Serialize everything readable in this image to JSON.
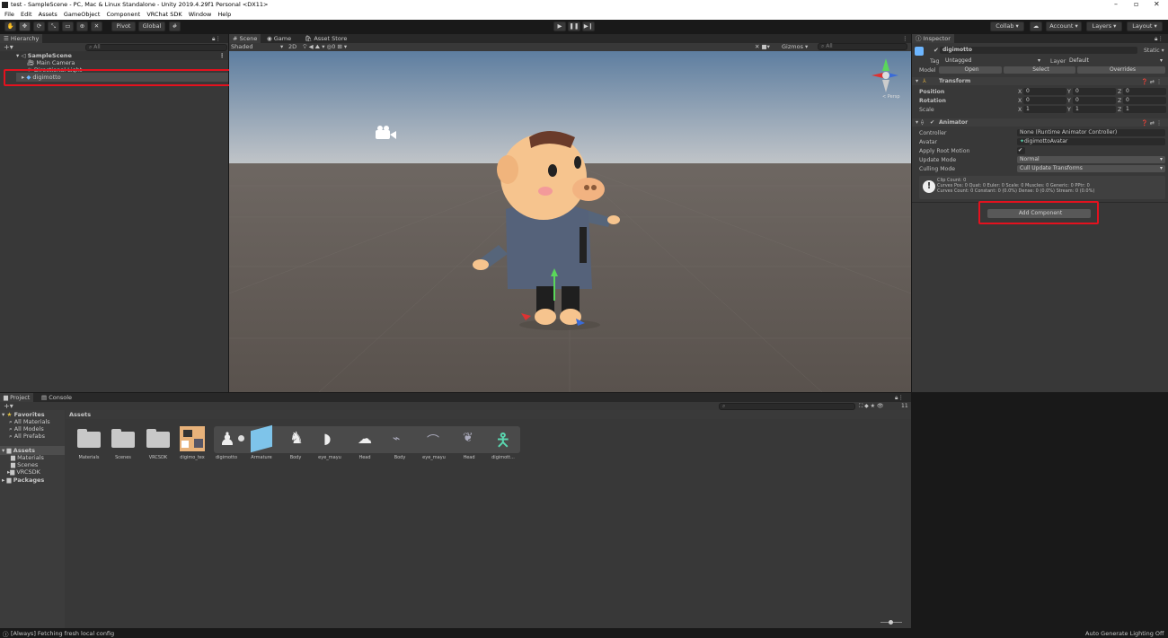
{
  "window": {
    "title": "test - SampleScene - PC, Mac & Linux Standalone - Unity 2019.4.29f1 Personal <DX11>",
    "min": "–",
    "max": "▫",
    "close": "✕"
  },
  "menu": [
    "File",
    "Edit",
    "Assets",
    "GameObject",
    "Component",
    "VRChat SDK",
    "Window",
    "Help"
  ],
  "toolbar": {
    "pivot": "Pivot",
    "global": "Global",
    "collab": "Collab ▾",
    "cloud": "☁",
    "account": "Account ▾",
    "layers": "Layers ▾",
    "layout": "Layout ▾"
  },
  "hierarchy": {
    "tab": "Hierarchy",
    "search_placeholder": "All",
    "scene": "SampleScene",
    "items": [
      "Main Camera",
      "Directional Light",
      "digimotto"
    ]
  },
  "scene": {
    "tabs": [
      "Scene",
      "Game",
      "Asset Store"
    ],
    "shading": "Shaded",
    "mode2d": "2D",
    "gizmos": "Gizmos ▾",
    "search_placeholder": "All",
    "persp": "< Persp"
  },
  "inspector": {
    "tab": "Inspector",
    "object_name": "digimotto",
    "static": "Static ▾",
    "tag_label": "Tag",
    "tag_value": "Untagged",
    "layer_label": "Layer",
    "layer_value": "Default",
    "model_label": "Model",
    "open": "Open",
    "select": "Select",
    "overrides": "Overrides",
    "transform": {
      "title": "Transform",
      "rows": [
        {
          "label": "Position",
          "x": "0",
          "y": "0",
          "z": "0"
        },
        {
          "label": "Rotation",
          "x": "0",
          "y": "0",
          "z": "0"
        },
        {
          "label": "Scale",
          "x": "1",
          "y": "1",
          "z": "1"
        }
      ]
    },
    "animator": {
      "title": "Animator",
      "fields": [
        {
          "label": "Controller",
          "value": "None (Runtime Animator Controller)"
        },
        {
          "label": "Avatar",
          "value": "digimottoAvatar"
        },
        {
          "label": "Apply Root Motion",
          "value": "✔"
        },
        {
          "label": "Update Mode",
          "value": "Normal"
        },
        {
          "label": "Culling Mode",
          "value": "Cull Update Transforms"
        }
      ],
      "info": [
        "Clip Count: 0",
        "Curves Pos: 0 Quat: 0 Euler: 0 Scale: 0 Muscles: 0 Generic: 0 PPtr: 0",
        "Curves Count: 0 Constant: 0 (0.0%) Dense: 0 (0.0%) Stream: 0 (0.0%)"
      ]
    },
    "add_component": "Add Component"
  },
  "project": {
    "tabs": [
      "Project",
      "Console"
    ],
    "favorites": {
      "title": "Favorites",
      "items": [
        "All Materials",
        "All Models",
        "All Prefabs"
      ]
    },
    "assets_tree": {
      "title": "Assets",
      "items": [
        "Materials",
        "Scenes",
        "VRCSDK"
      ]
    },
    "packages": "Packages",
    "breadcrumb": "Assets",
    "item_count": "11",
    "assets": [
      {
        "name": "Materials",
        "kind": "folder"
      },
      {
        "name": "Scenes",
        "kind": "folder"
      },
      {
        "name": "VRCSDK",
        "kind": "folder"
      },
      {
        "name": "digimo_tex",
        "kind": "texture"
      },
      {
        "name": "digimotto",
        "kind": "model"
      },
      {
        "name": "Armature",
        "kind": "cube"
      },
      {
        "name": "Body",
        "kind": "mesh"
      },
      {
        "name": "eye_mayu",
        "kind": "mesh"
      },
      {
        "name": "Head",
        "kind": "mesh"
      },
      {
        "name": "Body",
        "kind": "mesh2"
      },
      {
        "name": "eye_mayu",
        "kind": "mesh2"
      },
      {
        "name": "Head",
        "kind": "mesh2"
      },
      {
        "name": "digimott...",
        "kind": "avatar"
      }
    ]
  },
  "status": {
    "left": "[Always] Fetching fresh local config",
    "right": "Auto Generate Lighting Off"
  }
}
